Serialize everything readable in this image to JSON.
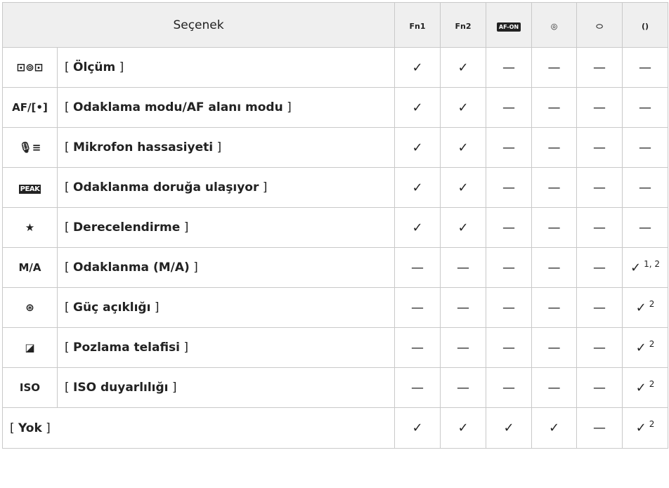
{
  "header": {
    "option_label": "Seçenek",
    "columns": [
      {
        "icon": "Fn1-lens-icon",
        "glyph": "Fn1"
      },
      {
        "icon": "Fn2-lens-icon",
        "glyph": "Fn2"
      },
      {
        "icon": "AF-ON-icon",
        "glyph": "AF-ON"
      },
      {
        "icon": "sub-selector-center-icon",
        "glyph": "◎"
      },
      {
        "icon": "video-record-icon",
        "glyph": "⬭"
      },
      {
        "icon": "control-ring-icon",
        "glyph": "()"
      }
    ]
  },
  "rows": [
    {
      "icon": "metering-icon",
      "icon_glyph": "⊡⊚⊡",
      "bracket_open": "[ ",
      "label": "Ölçüm",
      "bracket_close": " ]",
      "marks": [
        "✓",
        "✓",
        "—",
        "—",
        "—",
        "—"
      ],
      "notes": [
        "",
        "",
        "",
        "",
        "",
        ""
      ]
    },
    {
      "icon": "af-mode-icon",
      "icon_glyph": "AF/[•]",
      "bracket_open": "[ ",
      "label": "Odaklama modu/AF alanı modu",
      "bracket_close": " ]",
      "marks": [
        "✓",
        "✓",
        "—",
        "—",
        "—",
        "—"
      ],
      "notes": [
        "",
        "",
        "",
        "",
        "",
        ""
      ]
    },
    {
      "icon": "microphone-icon",
      "icon_glyph": "🎙≡",
      "bracket_open": "[ ",
      "label": "Mikrofon hassasiyeti",
      "bracket_close": " ]",
      "marks": [
        "✓",
        "✓",
        "—",
        "—",
        "—",
        "—"
      ],
      "notes": [
        "",
        "",
        "",
        "",
        "",
        ""
      ]
    },
    {
      "icon": "peak-icon",
      "icon_glyph": "PEAK",
      "bracket_open": "[ ",
      "label": "Odaklanma doruğa ulaşıyor",
      "bracket_close": " ]",
      "marks": [
        "✓",
        "✓",
        "—",
        "—",
        "—",
        "—"
      ],
      "notes": [
        "",
        "",
        "",
        "",
        "",
        ""
      ]
    },
    {
      "icon": "star-icon",
      "icon_glyph": "★",
      "bracket_open": "[ ",
      "label": "Derecelendirme",
      "bracket_close": " ]",
      "marks": [
        "✓",
        "✓",
        "—",
        "—",
        "—",
        "—"
      ],
      "notes": [
        "",
        "",
        "",
        "",
        "",
        ""
      ]
    },
    {
      "icon": "ma-icon",
      "icon_glyph": "M/A",
      "bracket_open": "[ ",
      "label": "Odaklanma (M/A)",
      "bracket_close": " ]",
      "marks": [
        "—",
        "—",
        "—",
        "—",
        "—",
        "✓"
      ],
      "notes": [
        "",
        "",
        "",
        "",
        "",
        "1, 2"
      ]
    },
    {
      "icon": "aperture-icon",
      "icon_glyph": "⊛",
      "bracket_open": "[ ",
      "label": "Güç açıklığı",
      "bracket_close": " ]",
      "marks": [
        "—",
        "—",
        "—",
        "—",
        "—",
        "✓"
      ],
      "notes": [
        "",
        "",
        "",
        "",
        "",
        "2"
      ]
    },
    {
      "icon": "exposure-comp-icon",
      "icon_glyph": "◪",
      "bracket_open": "[ ",
      "label": "Pozlama telafisi",
      "bracket_close": " ]",
      "marks": [
        "—",
        "—",
        "—",
        "—",
        "—",
        "✓"
      ],
      "notes": [
        "",
        "",
        "",
        "",
        "",
        "2"
      ]
    },
    {
      "icon": "iso-icon",
      "icon_glyph": "ISO",
      "bracket_open": "[ ",
      "label": "ISO duyarlılığı",
      "bracket_close": " ]",
      "marks": [
        "—",
        "—",
        "—",
        "—",
        "—",
        "✓"
      ],
      "notes": [
        "",
        "",
        "",
        "",
        "",
        "2"
      ]
    }
  ],
  "last_row": {
    "bracket_open": "[ ",
    "label": "Yok",
    "bracket_close": " ]",
    "marks": [
      "✓",
      "✓",
      "✓",
      "✓",
      "—",
      "✓"
    ],
    "notes": [
      "",
      "",
      "",
      "",
      "",
      "2"
    ]
  }
}
